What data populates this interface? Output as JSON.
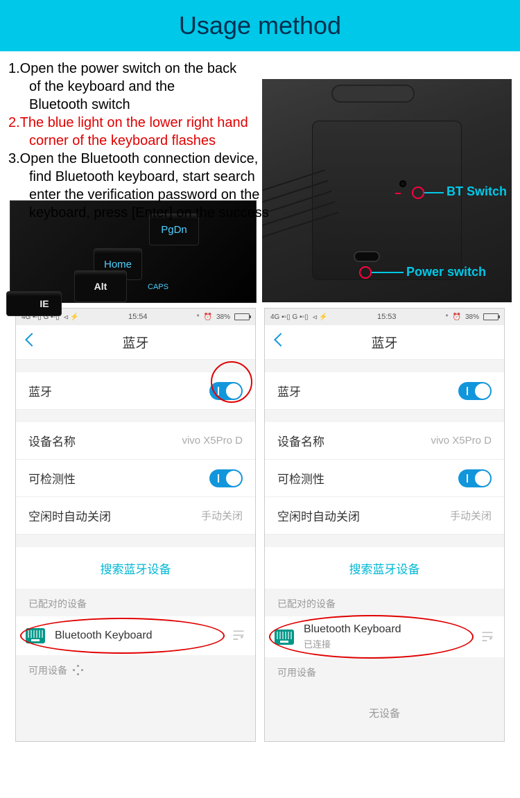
{
  "header": {
    "title": "Usage method"
  },
  "instructions": {
    "step1_a": "1.Open the power switch on the back",
    "step1_b": "of the keyboard and the",
    "step1_c": "Bluetooth switch",
    "step2_a": "2.The blue light on the lower right hand",
    "step2_b": "corner of the keyboard flashes",
    "step3_a": "3.Open the Bluetooth connection device,",
    "step3_b": "find Bluetooth keyboard, start search",
    "step3_c": "enter the verification password on the",
    "step3_d": "keyboard, press [Enter] on the success"
  },
  "keyboard_keys": {
    "pgdn": "PgDn",
    "home": "Home",
    "alt": "Alt",
    "ie": "IE",
    "caps": "CAPS"
  },
  "device_labels": {
    "bt": "BT Switch",
    "power": "Power switch"
  },
  "phone_left": {
    "status": {
      "net": "4G ▪▫▯ G ▪▫▯",
      "usb": "⏿ ⚡",
      "time": "15:54",
      "bt": "*",
      "alarm": "⏰",
      "batt": "38%"
    },
    "nav_title": "蓝牙",
    "bt_label": "蓝牙",
    "device_name_label": "设备名称",
    "device_name_value": "vivo X5Pro D",
    "discoverable_label": "可检测性",
    "idle_close_label": "空闲时自动关闭",
    "idle_close_value": "手动关闭",
    "search_label": "搜索蓝牙设备",
    "paired_section": "已配对的设备",
    "paired_device": "Bluetooth Keyboard",
    "avail_section": "可用设备"
  },
  "phone_right": {
    "status": {
      "net": "4G ▪▫▯ G ▪▫▯",
      "usb": "⏿ ⚡",
      "time": "15:53",
      "bt": "*",
      "alarm": "⏰",
      "batt": "38%"
    },
    "nav_title": "蓝牙",
    "bt_label": "蓝牙",
    "device_name_label": "设备名称",
    "device_name_value": "vivo X5Pro D",
    "discoverable_label": "可检测性",
    "idle_close_label": "空闲时自动关闭",
    "idle_close_value": "手动关闭",
    "search_label": "搜索蓝牙设备",
    "paired_section": "已配对的设备",
    "paired_device": "Bluetooth Keyboard",
    "paired_status": "已连接",
    "avail_section": "可用设备",
    "no_device": "无设备"
  }
}
